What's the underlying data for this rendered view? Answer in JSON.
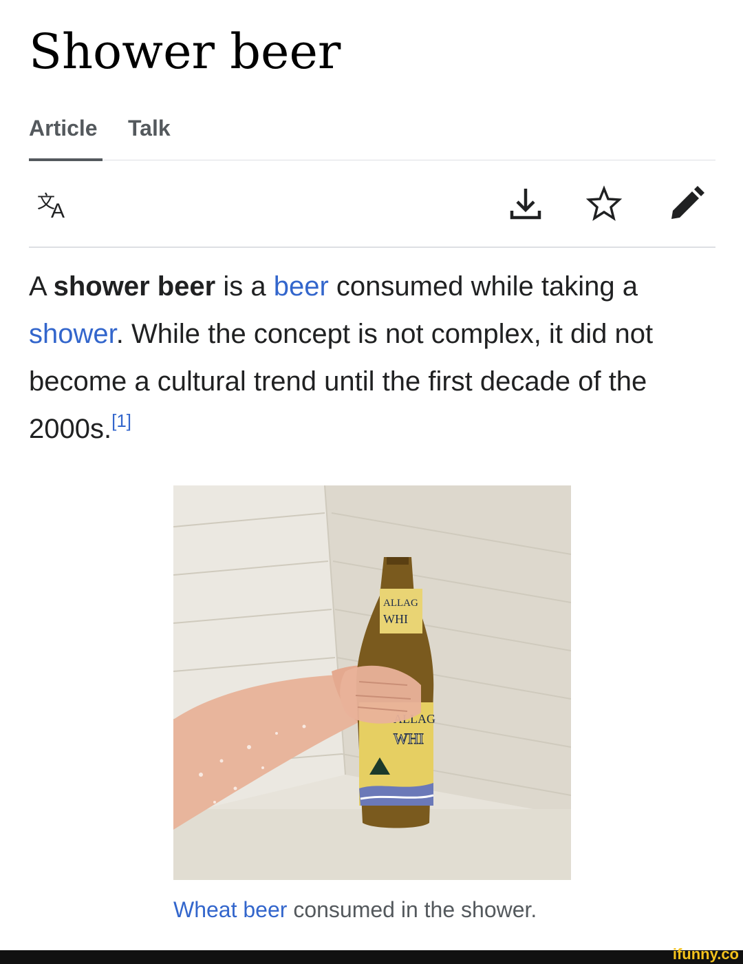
{
  "article": {
    "title": "Shower beer",
    "tabs": [
      {
        "label": "Article",
        "selected": true
      },
      {
        "label": "Talk",
        "selected": false
      }
    ]
  },
  "toolbar": {
    "icons": [
      "translate-icon",
      "download-icon",
      "star-icon",
      "edit-pencil-icon"
    ]
  },
  "lead": {
    "segments": {
      "s1": "A ",
      "s2_bold": "shower beer",
      "s3": " is a ",
      "s4_link": "beer",
      "s5": " consumed while taking a ",
      "s6_link": "shower",
      "s7": ". While the concept is not complex, it did not become a cultural trend until the first decade of the 2000s.",
      "ref": "[1]"
    }
  },
  "figure": {
    "bottle_label_top": "ALLAG",
    "bottle_label_top2": "WHI",
    "bottle_label_mid": "ALLAG",
    "bottle_label_mid2": "WHI",
    "caption_link": "Wheat beer",
    "caption_rest": " consumed in the shower."
  },
  "watermark": "ifunny.co",
  "colors": {
    "link": "#3366cc",
    "text": "#202122",
    "tab": "#54595d",
    "divider": "#dddfe3"
  }
}
